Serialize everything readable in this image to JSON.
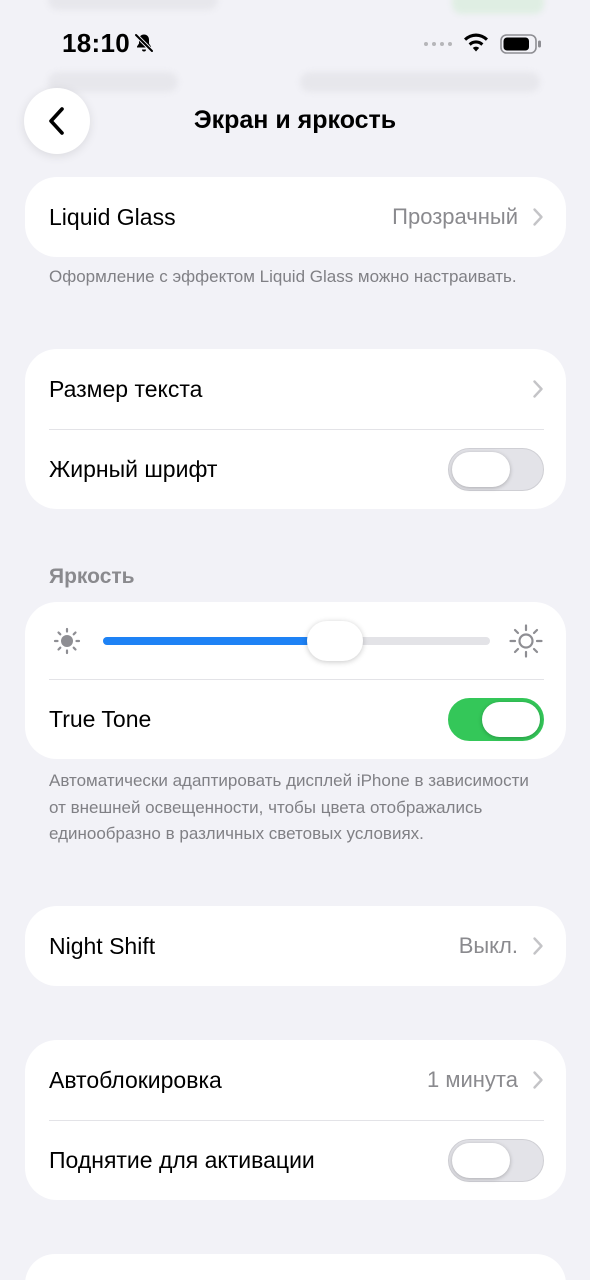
{
  "status_bar": {
    "time": "18:10",
    "silent_icon": "bell-slash-icon",
    "wifi_icon": "wifi-icon",
    "battery_icon": "battery-icon",
    "battery_level": 0.85
  },
  "nav": {
    "back_icon": "chevron-left-icon",
    "title": "Экран и яркость"
  },
  "appearance": {
    "label": "Liquid Glass",
    "value": "Прозрачный",
    "footnote": "Оформление с эффектом Liquid Glass можно настраивать."
  },
  "text": {
    "text_size_label": "Размер текста",
    "bold_text_label": "Жирный шрифт",
    "bold_text_on": false
  },
  "brightness": {
    "header": "Яркость",
    "level": 0.6,
    "true_tone_label": "True Tone",
    "true_tone_on": true,
    "footnote": "Автоматически адаптировать дисплей iPhone в зависимости от внешней освещенности, чтобы цвета отображались единообразно в различных световых условиях."
  },
  "night_shift": {
    "label": "Night Shift",
    "value": "Выкл."
  },
  "lock": {
    "auto_lock_label": "Автоблокировка",
    "auto_lock_value": "1 минута",
    "raise_to_wake_label": "Поднятие для активации",
    "raise_to_wake_on": false
  },
  "colors": {
    "accent_blue": "#1e82f5",
    "toggle_green": "#34c759",
    "background": "#f2f2f7"
  }
}
